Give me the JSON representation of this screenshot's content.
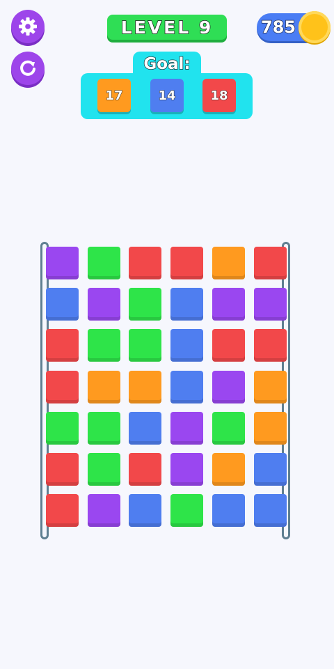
{
  "hud": {
    "level_label": "LEVEL 9",
    "coins": "785",
    "settings_icon": "gear-icon",
    "restart_icon": "restart-icon",
    "coin_icon": "coin-icon"
  },
  "goal": {
    "label": "Goal:",
    "targets": [
      {
        "color": "orange",
        "value": "17"
      },
      {
        "color": "blue",
        "value": "14"
      },
      {
        "color": "red",
        "value": "18"
      }
    ]
  },
  "colors": {
    "purple": "#9a47f0",
    "green": "#2ee449",
    "red": "#f2484a",
    "orange": "#ff9a1f",
    "blue": "#4f7ef0",
    "ui_purple": "#9d45ea",
    "level_green": "#2fde55",
    "goal_cyan": "#21e3ee",
    "coin_pill_blue": "#4a7df4",
    "coin_gold": "#ffc21a"
  },
  "board": [
    [
      "purple",
      "green",
      "red",
      "red",
      "orange",
      "red"
    ],
    [
      "blue",
      "purple",
      "green",
      "blue",
      "purple",
      "purple"
    ],
    [
      "red",
      "green",
      "green",
      "blue",
      "red",
      "red"
    ],
    [
      "red",
      "orange",
      "orange",
      "blue",
      "purple",
      "orange"
    ],
    [
      "green",
      "green",
      "blue",
      "purple",
      "green",
      "orange"
    ],
    [
      "red",
      "green",
      "red",
      "purple",
      "orange",
      "blue"
    ],
    [
      "red",
      "purple",
      "blue",
      "green",
      "blue",
      "blue"
    ]
  ]
}
